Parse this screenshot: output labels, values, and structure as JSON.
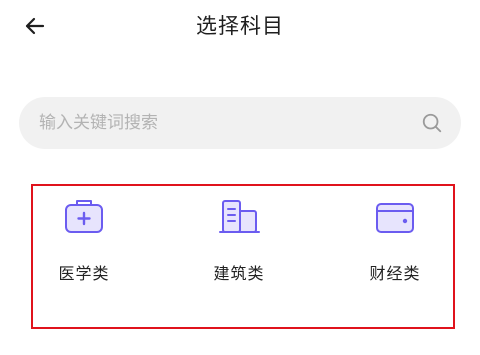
{
  "header": {
    "back_icon": "arrow-left-icon",
    "title": "选择科目"
  },
  "search": {
    "placeholder": "输入关键词搜索",
    "value": "",
    "icon": "search-icon"
  },
  "categories": [
    {
      "label": "医学类",
      "icon": "medical-kit-icon"
    },
    {
      "label": "建筑类",
      "icon": "building-icon"
    },
    {
      "label": "财经类",
      "icon": "wallet-icon"
    }
  ],
  "colors": {
    "icon_accent": "#6b5cf0",
    "icon_fill": "#e7e4fd",
    "highlight_border": "#e0131c",
    "search_bg": "#f1f1f1"
  }
}
